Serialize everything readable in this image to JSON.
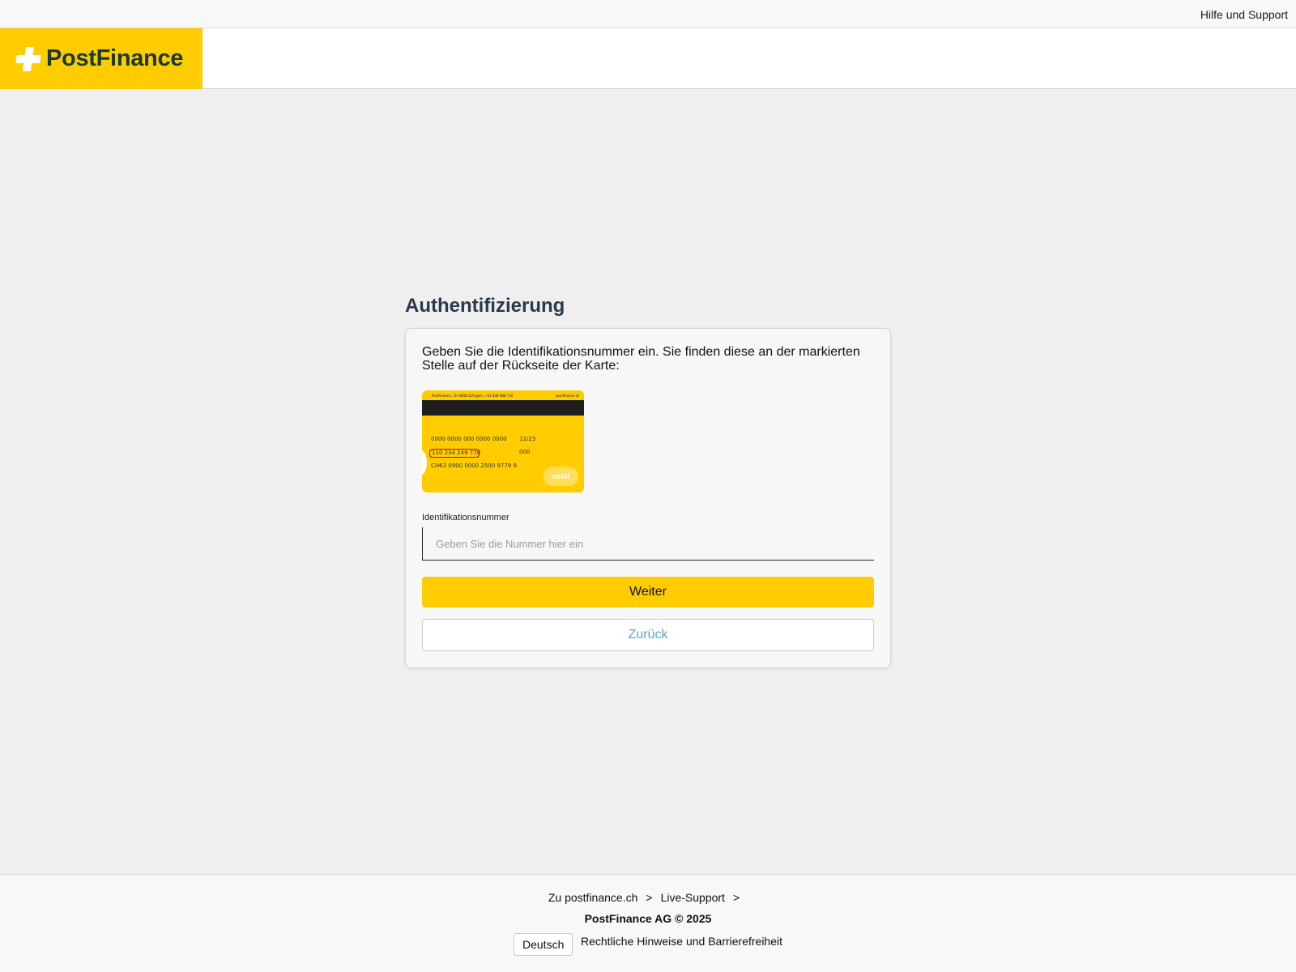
{
  "topbar": {
    "help_label": "Hilfe und Support"
  },
  "brand": {
    "name": "PostFinance",
    "color": "#ffcc00",
    "text_color": "#1a3a34"
  },
  "main": {
    "title": "Authentifizierung",
    "instruction": "Geben Sie die Identifikationsnummer ein. Sie finden diese an der markierten Stelle auf der Rückseite der Karte:",
    "card_image": {
      "header_left": "PostFinance, CH-4808 Zofingen, +41 848 888 710",
      "header_right": "postfinance.ch",
      "card_number": "0000 0000 000 0000 0000",
      "valid_thru": "12/23",
      "id_number": "110 234 249 778",
      "cvc": "000",
      "iban": "CH63 0900 0000 2500 9779 8",
      "badge": "debit"
    },
    "field_label": "Identifikationsnummer",
    "field_placeholder": "Geben Sie die Nummer hier ein",
    "field_value": "",
    "primary_button": "Weiter",
    "secondary_button": "Zurück"
  },
  "footer": {
    "links": [
      {
        "label": "Zu postfinance.ch",
        "arrow": ">"
      },
      {
        "label": "Live-Support",
        "arrow": ">"
      }
    ],
    "copyright": "PostFinance AG © 2025",
    "language": "Deutsch",
    "legal": "Rechtliche Hinweise und Barrierefreiheit"
  }
}
